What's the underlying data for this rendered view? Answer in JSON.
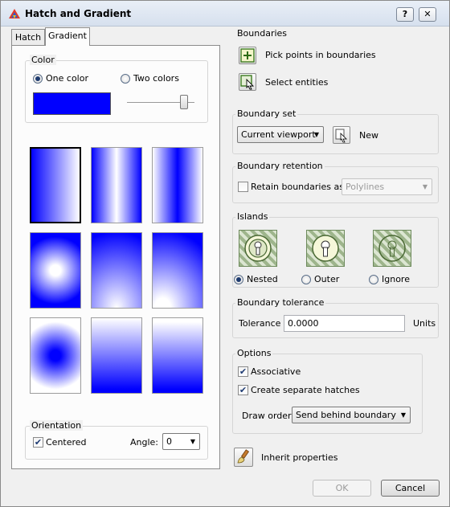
{
  "window": {
    "title": "Hatch and Gradient",
    "help_label": "?",
    "close_label": "✕"
  },
  "tabs": [
    {
      "label": "Hatch",
      "active": false
    },
    {
      "label": "Gradient",
      "active": true
    }
  ],
  "color": {
    "title": "Color",
    "one_color_label": "One color",
    "two_colors_label": "Two colors",
    "selected": "One color",
    "swatch_color": "#0000ff",
    "shade_tint_level": 0.85
  },
  "gradients": {
    "primary_color": "#0000ff",
    "selected_index": 0,
    "patterns": [
      "linear",
      "cylinder",
      "inverted-cylinder",
      "spherical",
      "hemispherical",
      "curved",
      "inverted-spherical",
      "inverted-hemispherical",
      "inverted-curved"
    ]
  },
  "orientation": {
    "title": "Orientation",
    "centered_label": "Centered",
    "centered": true,
    "angle_label": "Angle:",
    "angle_value": "0"
  },
  "boundaries": {
    "title": "Boundaries",
    "pick_points_label": "Pick points in boundaries",
    "select_entities_label": "Select entities"
  },
  "boundary_set": {
    "title": "Boundary set",
    "value": "Current viewport",
    "new_label": "New"
  },
  "boundary_retention": {
    "title": "Boundary retention",
    "retain_label": "Retain boundaries as",
    "retain": false,
    "type_value": "Polylines"
  },
  "islands": {
    "title": "Islands",
    "options": [
      {
        "label": "Nested",
        "selected": true
      },
      {
        "label": "Outer",
        "selected": false
      },
      {
        "label": "Ignore",
        "selected": false
      }
    ]
  },
  "boundary_tolerance": {
    "title": "Boundary tolerance",
    "tolerance_label": "Tolerance",
    "value": "0.0000",
    "units_label": "Units"
  },
  "options": {
    "title": "Options",
    "associative_label": "Associative",
    "associative": true,
    "separate_label": "Create separate hatches",
    "separate": true,
    "draw_order_label": "Draw order",
    "draw_order_value": "Send behind boundary"
  },
  "inherit_label": "Inherit properties",
  "buttons": {
    "ok_label": "OK",
    "cancel_label": "Cancel"
  }
}
